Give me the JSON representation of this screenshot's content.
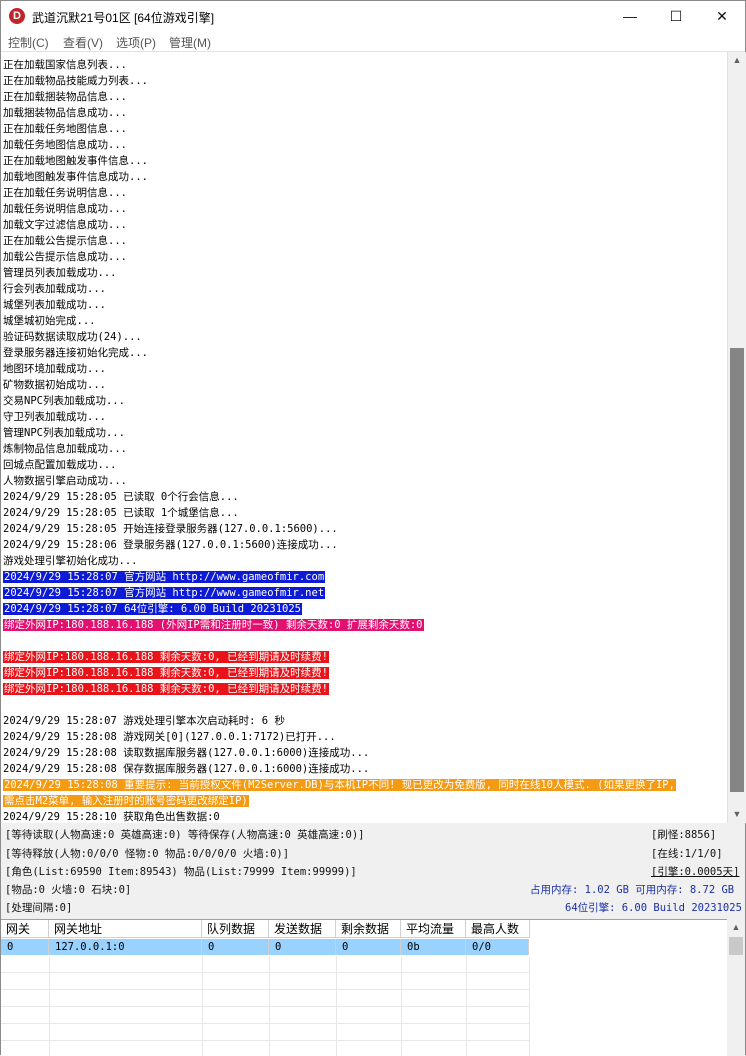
{
  "window": {
    "icon_letter": "D",
    "title": "武道沉默21号01区 [64位游戏引擎]",
    "minimize": "—",
    "maximize": "☐",
    "close": "✕"
  },
  "menu": [
    "控制(C)",
    "查看(V)",
    "选项(P)",
    "管理(M)"
  ],
  "log": [
    {
      "text": "正在加载国家信息列表...",
      "style": ""
    },
    {
      "text": "正在加载物品技能威力列表...",
      "style": ""
    },
    {
      "text": "正在加载捆装物品信息...",
      "style": ""
    },
    {
      "text": "加载捆装物品信息成功...",
      "style": ""
    },
    {
      "text": "正在加载任务地图信息...",
      "style": ""
    },
    {
      "text": "加载任务地图信息成功...",
      "style": ""
    },
    {
      "text": "正在加载地图触发事件信息...",
      "style": ""
    },
    {
      "text": "加载地图触发事件信息成功...",
      "style": ""
    },
    {
      "text": "正在加载任务说明信息...",
      "style": ""
    },
    {
      "text": "加载任务说明信息成功...",
      "style": ""
    },
    {
      "text": "加载文字过滤信息成功...",
      "style": ""
    },
    {
      "text": "正在加载公告提示信息...",
      "style": ""
    },
    {
      "text": "加载公告提示信息成功...",
      "style": ""
    },
    {
      "text": "管理员列表加载成功...",
      "style": ""
    },
    {
      "text": "行会列表加载成功...",
      "style": ""
    },
    {
      "text": "城堡列表加载成功...",
      "style": ""
    },
    {
      "text": "城堡城初始完成...",
      "style": ""
    },
    {
      "text": "验证码数据读取成功(24)...",
      "style": ""
    },
    {
      "text": "登录服务器连接初始化完成...",
      "style": ""
    },
    {
      "text": "地图环境加载成功...",
      "style": ""
    },
    {
      "text": "矿物数据初始成功...",
      "style": ""
    },
    {
      "text": "交易NPC列表加载成功...",
      "style": ""
    },
    {
      "text": "守卫列表加载成功...",
      "style": ""
    },
    {
      "text": "管理NPC列表加载成功...",
      "style": ""
    },
    {
      "text": "炼制物品信息加载成功...",
      "style": ""
    },
    {
      "text": "回城点配置加载成功...",
      "style": ""
    },
    {
      "text": "人物数据引擎启动成功...",
      "style": ""
    },
    {
      "text": "2024/9/29 15:28:05 已读取 0个行会信息...",
      "style": ""
    },
    {
      "text": "2024/9/29 15:28:05 已读取 1个城堡信息...",
      "style": ""
    },
    {
      "text": "2024/9/29 15:28:05 开始连接登录服务器(127.0.0.1:5600)...",
      "style": ""
    },
    {
      "text": "2024/9/29 15:28:06 登录服务器(127.0.0.1:5600)连接成功...",
      "style": ""
    },
    {
      "text": "游戏处理引擎初始化成功...",
      "style": ""
    },
    {
      "text": "2024/9/29 15:28:07 官方网站 http://www.gameofmir.com",
      "style": "blue"
    },
    {
      "text": "2024/9/29 15:28:07 官方网站 http://www.gameofmir.net",
      "style": "blue"
    },
    {
      "text": "2024/9/29 15:28:07 64位引擎: 6.00 Build 20231025",
      "style": "blue"
    },
    {
      "text": "绑定外网IP:180.188.16.188 (外网IP需和注册时一致) 剩余天数:0 扩展剩余天数:0",
      "style": "pink"
    },
    {
      "text": "",
      "style": ""
    },
    {
      "text": "绑定外网IP:180.188.16.188 剩余天数:0, 已经到期请及时续费!",
      "style": "red"
    },
    {
      "text": "绑定外网IP:180.188.16.188 剩余天数:0, 已经到期请及时续费!",
      "style": "red"
    },
    {
      "text": "绑定外网IP:180.188.16.188 剩余天数:0, 已经到期请及时续费!",
      "style": "red"
    },
    {
      "text": "",
      "style": ""
    },
    {
      "text": "2024/9/29 15:28:07 游戏处理引擎本次启动耗时: 6 秒",
      "style": ""
    },
    {
      "text": "2024/9/29 15:28:08 游戏网关[0](127.0.0.1:7172)已打开...",
      "style": ""
    },
    {
      "text": "2024/9/29 15:28:08 读取数据库服务器(127.0.0.1:6000)连接成功...",
      "style": ""
    },
    {
      "text": "2024/9/29 15:28:08 保存数据库服务器(127.0.0.1:6000)连接成功...",
      "style": ""
    },
    {
      "text": "2024/9/29 15:28:08 重要提示: 当前授权文件(M2Server.DB)与本机IP不同! 现已更改为免费版, 同时在线10人模式. (如果更换了IP,",
      "style": "orange"
    },
    {
      "text": "需点击M2菜单, 输入注册时的账号密码更改绑定IP)",
      "style": "orange"
    },
    {
      "text": "2024/9/29 15:28:10 获取角色出售数据:0",
      "style": ""
    }
  ],
  "status": {
    "r1_left": "[等待读取(人物高速:0 英雄高速:0) 等待保存(人物高速:0 英雄高速:0)]",
    "r1_right": "[刷怪:8856]",
    "r2_left": "[等待释放(人物:0/0/0 怪物:0 物品:0/0/0/0 火墙:0)]",
    "r2_right": "[在线:1/1/0]",
    "r3_left": "[角色(List:69590 Item:89543) 物品(List:79999 Item:99999)]",
    "r3_right": "[引擎:0.0005天]",
    "r4_left": "[物品:0 火墙:0 石块:0]",
    "r4_right": "占用内存: 1.02 GB 可用内存: 8.72 GB",
    "r5_left": "[处理间隔:0]",
    "r5_right": "64位引擎: 6.00 Build 20231025"
  },
  "grid": {
    "headers": [
      "网关",
      "网关地址",
      "队列数据",
      "发送数据",
      "剩余数据",
      "平均流量",
      "最高人数"
    ],
    "rows": [
      [
        "0",
        "127.0.0.1:0",
        "0",
        "0",
        "0",
        "0b",
        "0/0"
      ]
    ]
  },
  "colors": {
    "highlight_blue": "#0d1bd6",
    "highlight_pink": "#e2106f",
    "highlight_red": "#e8141a",
    "highlight_orange": "#f59a13",
    "selected_row": "#99d1ff",
    "status_blue": "#1a2fa8"
  }
}
